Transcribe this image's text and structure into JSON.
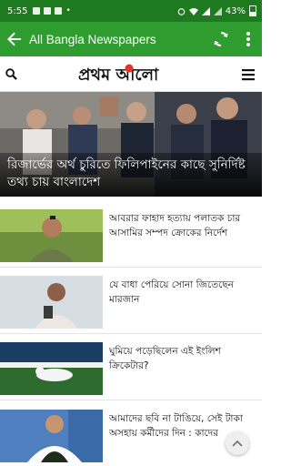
{
  "status": {
    "time": "5:55",
    "battery": "43%"
  },
  "appbar": {
    "title": "All Bangla Newspapers"
  },
  "site": {
    "logo_text": "প্রথম আলো"
  },
  "hero": {
    "headline": "রিজার্ভের অর্থ চুরিতে ফিলিপাইনের কাছে সুনির্দিষ্ট তথ্য চায় বাংলাদেশ"
  },
  "articles": [
    {
      "title": "আবরার ফাহাদ হত্যায় পলাতক চার আসামির সম্পদ ক্রোকের নির্দেশ"
    },
    {
      "title": "যে বাধা পেরিয়ে সোনা জিতেছেন মারজান"
    },
    {
      "title": "ঘুমিয়ে পড়েছিলেন এই ইংলিশ ক্রিকেটার?"
    },
    {
      "title": "আমাদের ছবি না টাঙিয়ে, সেই টাকা অসহায় কর্মীদের দিন : কাদের"
    }
  ],
  "colors": {
    "status_green": "#1e7a1e",
    "appbar_green": "#2e9c2e",
    "logo_red": "#e8312a"
  }
}
